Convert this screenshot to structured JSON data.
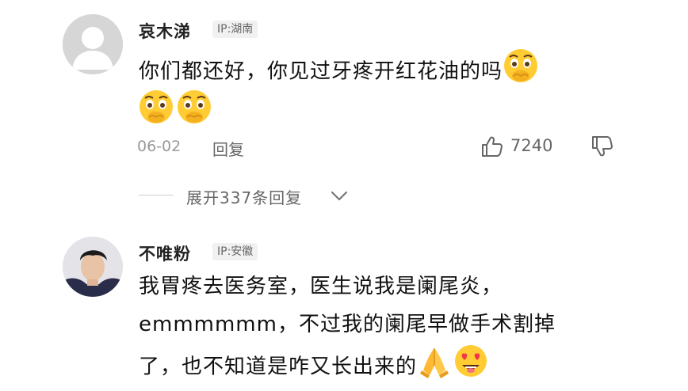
{
  "comments": [
    {
      "username": "哀木涕",
      "ip": "IP:湖南",
      "text_line1": "你们都还好，你见过牙疼开红花油的吗",
      "date": "06-02",
      "reply_label": "回复",
      "likes": "7240",
      "expand_label": "展开337条回复"
    },
    {
      "username": "不唯粉",
      "ip": "IP:安徽",
      "text_line1": "我胃疼去医务室，医生说我是阑尾炎，",
      "text_line2": "emmmmmm，不过我的阑尾早做手术割掉",
      "text_line3": "了，也不知道是咋又长出来的"
    }
  ],
  "icons": {
    "blush_emoji": "face-holding-back-tears-emoji",
    "pray_emoji": "folded-hands-emoji",
    "heart_eyes_emoji": "heart-eyes-emoji",
    "like": "thumbs-up-icon",
    "dislike": "thumbs-down-icon",
    "expand": "chevron-down-icon"
  },
  "colors": {
    "muted_text": "#999999",
    "badge_bg": "#f1f1f1",
    "emoji_yellow": "#ffcc33"
  }
}
